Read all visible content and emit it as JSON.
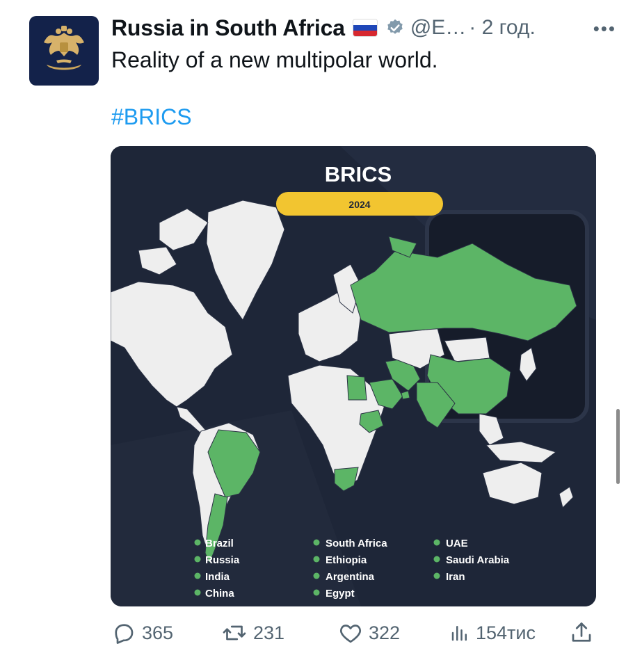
{
  "tweet": {
    "author_name": "Russia in South Africa",
    "handle": "@E…",
    "time": "· 2 год.",
    "text": "Reality of a new multipolar world.",
    "hashtag": "#BRICS"
  },
  "icons": {
    "avatar": "double-headed-eagle-emblem",
    "flag": "russia-flag",
    "verified": "verified-badge-icon",
    "more": "more-icon",
    "reply": "reply-icon",
    "retweet": "retweet-icon",
    "like": "like-icon",
    "views": "views-icon",
    "share": "share-icon"
  },
  "colors": {
    "brics_green": "#5cb566",
    "map_background": "#1e2638",
    "year_pill": "#f2c530",
    "link": "#1d9bf0"
  },
  "infographic": {
    "title": "BRICS",
    "year": "2024",
    "legend": [
      [
        "Brazil",
        "Russia",
        "India",
        "China"
      ],
      [
        "South Africa",
        "Ethiopia",
        "Argentina",
        "Egypt"
      ],
      [
        "UAE",
        "Saudi Arabia",
        "Iran"
      ]
    ]
  },
  "stats": {
    "replies": "365",
    "reposts": "231",
    "likes": "322",
    "views": "154тис"
  },
  "more_label": "•••"
}
